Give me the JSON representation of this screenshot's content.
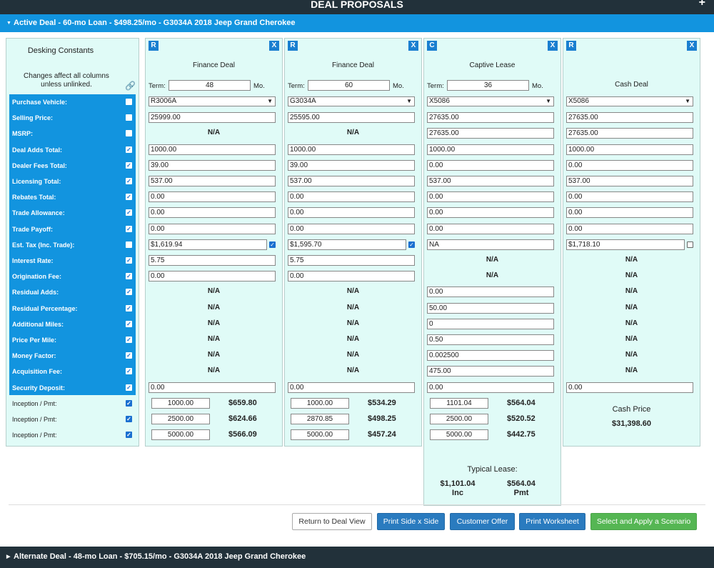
{
  "header": {
    "title": "DEAL PROPOSALS",
    "plus": "+"
  },
  "active_bar": "Active Deal - 60-mo Loan - $498.25/mo - G3034A 2018 Jeep Grand Cherokee",
  "alternate_bar": "Alternate Deal - 48-mo Loan - $705.15/mo - G3034A 2018 Jeep Grand Cherokee",
  "constants": {
    "title": "Desking Constants",
    "note": "Changes affect all columns unless unlinked.",
    "rows": [
      {
        "label": "Purchase Vehicle:",
        "checked": false
      },
      {
        "label": "Selling Price:",
        "checked": false
      },
      {
        "label": "MSRP:",
        "checked": false
      },
      {
        "label": "Deal Adds Total:",
        "checked": true
      },
      {
        "label": "Dealer Fees Total:",
        "checked": true
      },
      {
        "label": "Licensing Total:",
        "checked": true
      },
      {
        "label": "Rebates Total:",
        "checked": true
      },
      {
        "label": "Trade Allowance:",
        "checked": true
      },
      {
        "label": "Trade Payoff:",
        "checked": true
      },
      {
        "label": "Est. Tax (Inc. Trade):",
        "checked": false
      },
      {
        "label": "Interest Rate:",
        "checked": true
      },
      {
        "label": "Origination Fee:",
        "checked": true
      },
      {
        "label": "Residual Adds:",
        "checked": true
      },
      {
        "label": "Residual Percentage:",
        "checked": true
      },
      {
        "label": "Additional Miles:",
        "checked": true
      },
      {
        "label": "Price Per Mile:",
        "checked": true
      },
      {
        "label": "Money Factor:",
        "checked": true
      },
      {
        "label": "Acquisition Fee:",
        "checked": true
      },
      {
        "label": "Security Deposit:",
        "checked": true
      }
    ],
    "inception_label": "Inception / Pmt:"
  },
  "labels": {
    "term": "Term:",
    "mo": "Mo.",
    "na": "N/A",
    "close": "X"
  },
  "columns": [
    {
      "badge": "R",
      "title": "Finance Deal",
      "term": "48",
      "vehicle": "R3006A",
      "fields": [
        "25999.00",
        "N/A",
        "1000.00",
        "39.00",
        "537.00",
        "0.00",
        "0.00",
        "0.00",
        "$1,619.94",
        "5.75",
        "0.00",
        "N/A",
        "N/A",
        "N/A",
        "N/A",
        "N/A",
        "N/A",
        "0.00"
      ],
      "tax_checked": true,
      "inceptions": [
        {
          "amount": "1000.00",
          "pmt": "$659.80"
        },
        {
          "amount": "2500.00",
          "pmt": "$624.66"
        },
        {
          "amount": "5000.00",
          "pmt": "$566.09"
        }
      ]
    },
    {
      "badge": "R",
      "title": "Finance Deal",
      "term": "60",
      "vehicle": "G3034A",
      "fields": [
        "25595.00",
        "N/A",
        "1000.00",
        "39.00",
        "537.00",
        "0.00",
        "0.00",
        "0.00",
        "$1,595.70",
        "5.75",
        "0.00",
        "N/A",
        "N/A",
        "N/A",
        "N/A",
        "N/A",
        "N/A",
        "0.00"
      ],
      "tax_checked": true,
      "inceptions": [
        {
          "amount": "1000.00",
          "pmt": "$534.29"
        },
        {
          "amount": "2870.85",
          "pmt": "$498.25"
        },
        {
          "amount": "5000.00",
          "pmt": "$457.24"
        }
      ]
    },
    {
      "badge": "C",
      "title": "Captive Lease",
      "term": "36",
      "vehicle": "X5086",
      "fields": [
        "27635.00",
        "27635.00",
        "1000.00",
        "0.00",
        "537.00",
        "0.00",
        "0.00",
        "0.00",
        "NA",
        "N/A",
        "N/A",
        "0.00",
        "50.00",
        "0",
        "0.50",
        "0.002500",
        "475.00",
        "0.00"
      ],
      "inceptions": [
        {
          "amount": "1101.04",
          "pmt": "$564.04"
        },
        {
          "amount": "2500.00",
          "pmt": "$520.52"
        },
        {
          "amount": "5000.00",
          "pmt": "$442.75"
        }
      ],
      "typical": {
        "title": "Typical Lease:",
        "inc": "$1,101.04",
        "inc_label": "Inc",
        "pmt": "$564.04",
        "pmt_label": "Pmt"
      }
    },
    {
      "badge": "R",
      "title": "Cash Deal",
      "vehicle": "X5086",
      "fields": [
        "27635.00",
        "27635.00",
        "1000.00",
        "0.00",
        "537.00",
        "0.00",
        "0.00",
        "0.00",
        "$1,718.10",
        "N/A",
        "N/A",
        "N/A",
        "N/A",
        "N/A",
        "N/A",
        "N/A",
        "N/A",
        "0.00"
      ],
      "tax_checked": false,
      "cash_price_label": "Cash Price",
      "cash_price": "$31,398.60"
    }
  ],
  "buttons": {
    "return": "Return to Deal View",
    "print_side": "Print Side x Side",
    "customer_offer": "Customer Offer",
    "print_worksheet": "Print Worksheet",
    "select_apply": "Select and Apply a Scenario"
  }
}
